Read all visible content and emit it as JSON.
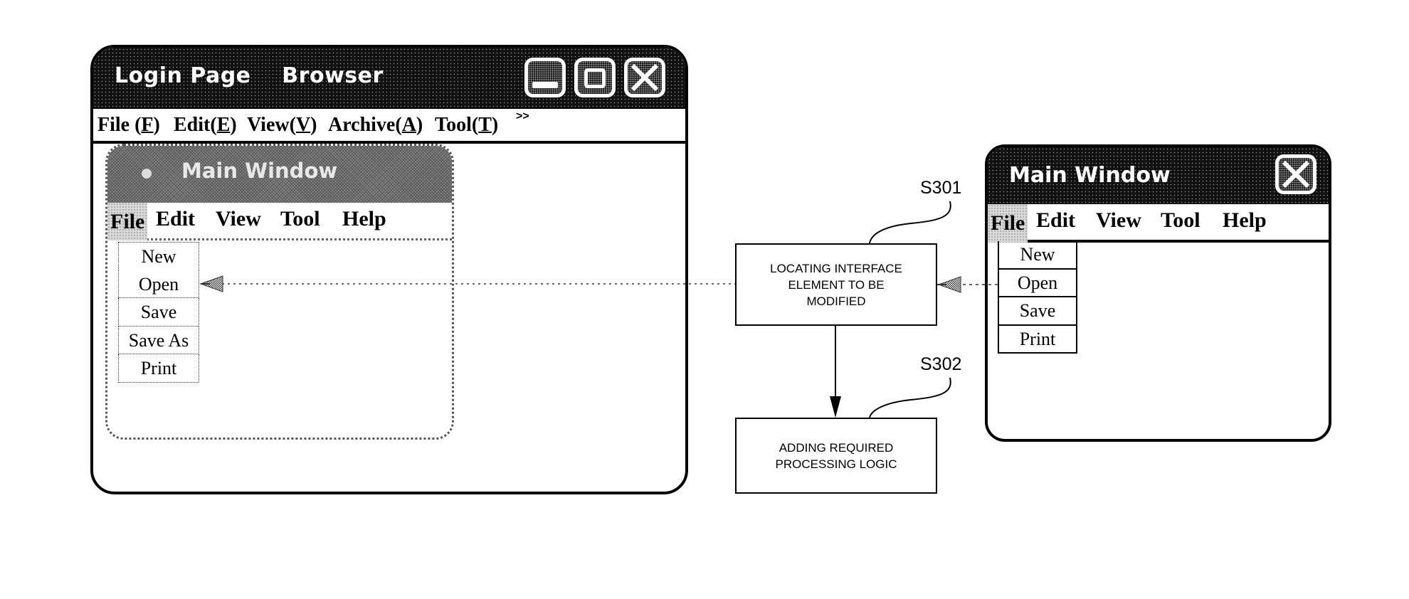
{
  "browser_window": {
    "title": "Login Page    Browser",
    "buttons": {
      "minimize": "minimize",
      "maximize": "maximize",
      "close": "close"
    },
    "menu": [
      {
        "label": "File (",
        "key": "F",
        "suffix": ")"
      },
      {
        "label": "Edit(",
        "key": "E",
        "suffix": ")"
      },
      {
        "label": "View(",
        "key": "V",
        "suffix": ")"
      },
      {
        "label": "Archive(",
        "key": "A",
        "suffix": ")"
      },
      {
        "label": "Tool(",
        "key": "T",
        "suffix": ")"
      }
    ],
    "more": ">>"
  },
  "left_main_window": {
    "title": "Main Window",
    "menu": [
      "File",
      "Edit",
      "View",
      "Tool",
      "Help"
    ],
    "file_menu_items": [
      "New",
      "Open",
      "Save",
      "Save As",
      "Print"
    ]
  },
  "right_main_window": {
    "title": "Main Window",
    "menu": [
      "File",
      "Edit",
      "View",
      "Tool",
      "Help"
    ],
    "file_menu_items": [
      "New",
      "Open",
      "Save",
      "Print"
    ]
  },
  "flowchart": {
    "steps": [
      {
        "id": "S301",
        "text": "LOCATING INTERFACE\nELEMENT TO BE\nMODIFIED"
      },
      {
        "id": "S302",
        "text": "ADDING REQUIRED\nPROCESSING LOGIC"
      }
    ]
  }
}
